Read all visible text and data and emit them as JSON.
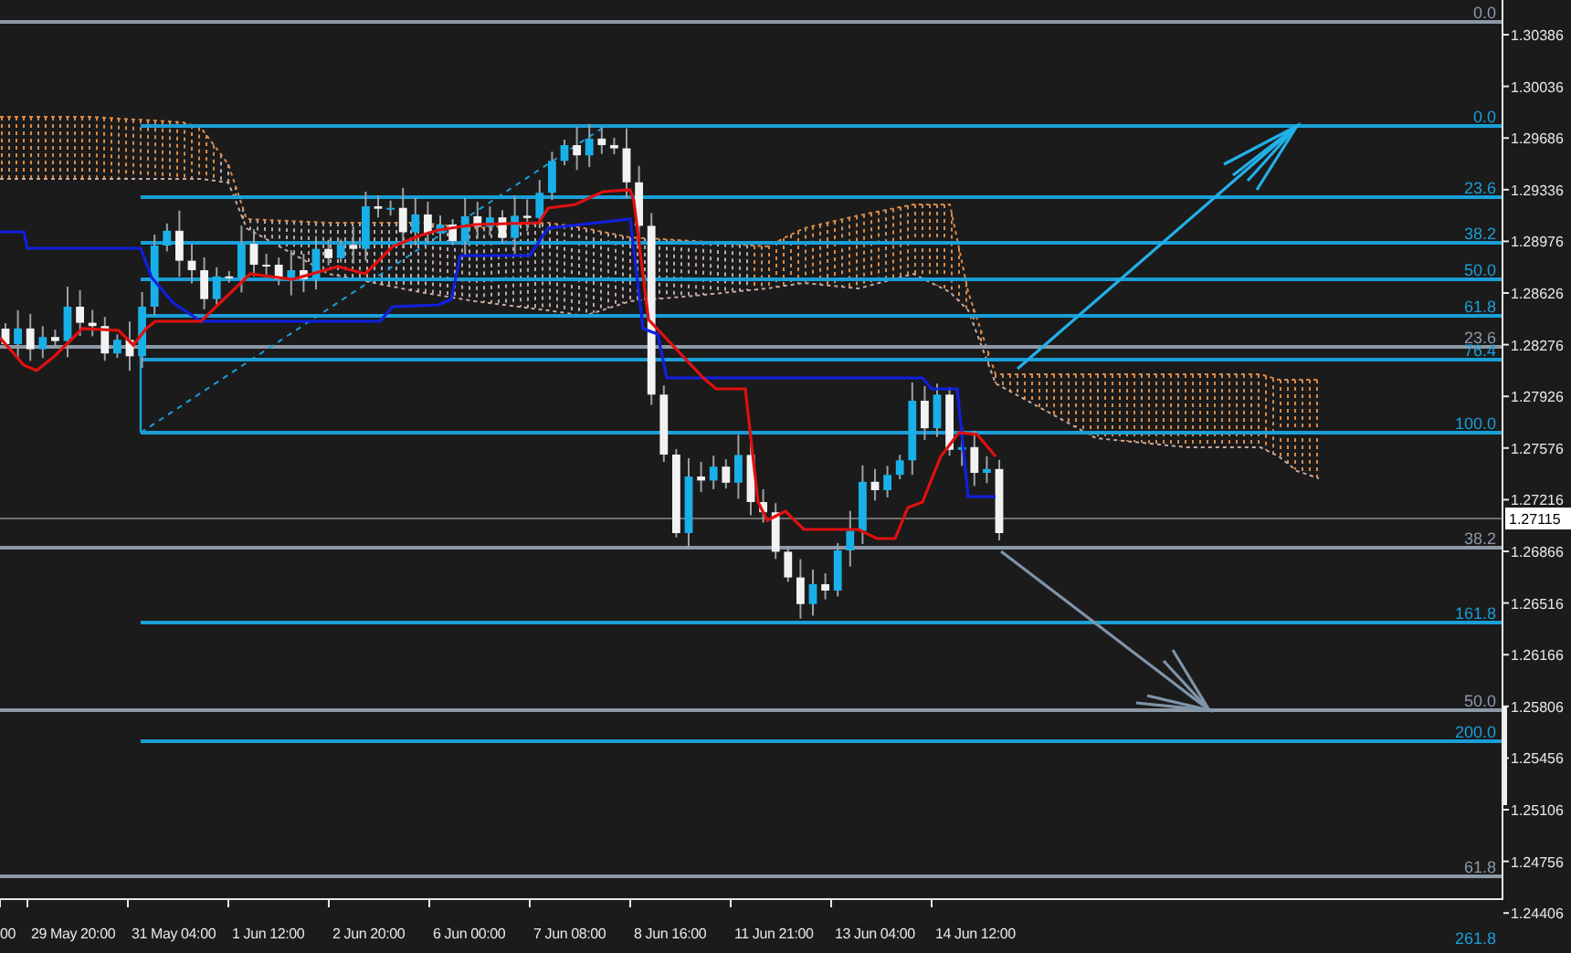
{
  "chart": {
    "price_axis": {
      "labels": [
        "1.30386",
        "1.30036",
        "1.29686",
        "1.29336",
        "1.28976",
        "1.28626",
        "1.28276",
        "1.27926",
        "1.27576",
        "1.27216",
        "1.26866",
        "1.26516",
        "1.26166",
        "1.25806",
        "1.25456",
        "1.25106",
        "1.24756",
        "1.24406"
      ]
    },
    "current_price": "1.27115",
    "time_axis": {
      "labels": [
        "00",
        "29 May 20:00",
        "31 May 04:00",
        "1 Jun 12:00",
        "2 Jun 20:00",
        "6 Jun 00:00",
        "7 Jun 08:00",
        "8 Jun 16:00",
        "11 Jun 21:00",
        "13 Jun 04:00",
        "14 Jun 12:00"
      ]
    },
    "fibonacci_sets": [
      {
        "color": "#8c99a6",
        "levels": [
          "0.0",
          "23.6",
          "38.2",
          "50.0",
          "61.8"
        ]
      },
      {
        "color": "#1a9fd8",
        "levels": [
          "0.0",
          "23.6",
          "38.2",
          "50.0",
          "61.8",
          "76.4",
          "100.0",
          "161.8",
          "200.0",
          "261.8"
        ]
      }
    ]
  }
}
